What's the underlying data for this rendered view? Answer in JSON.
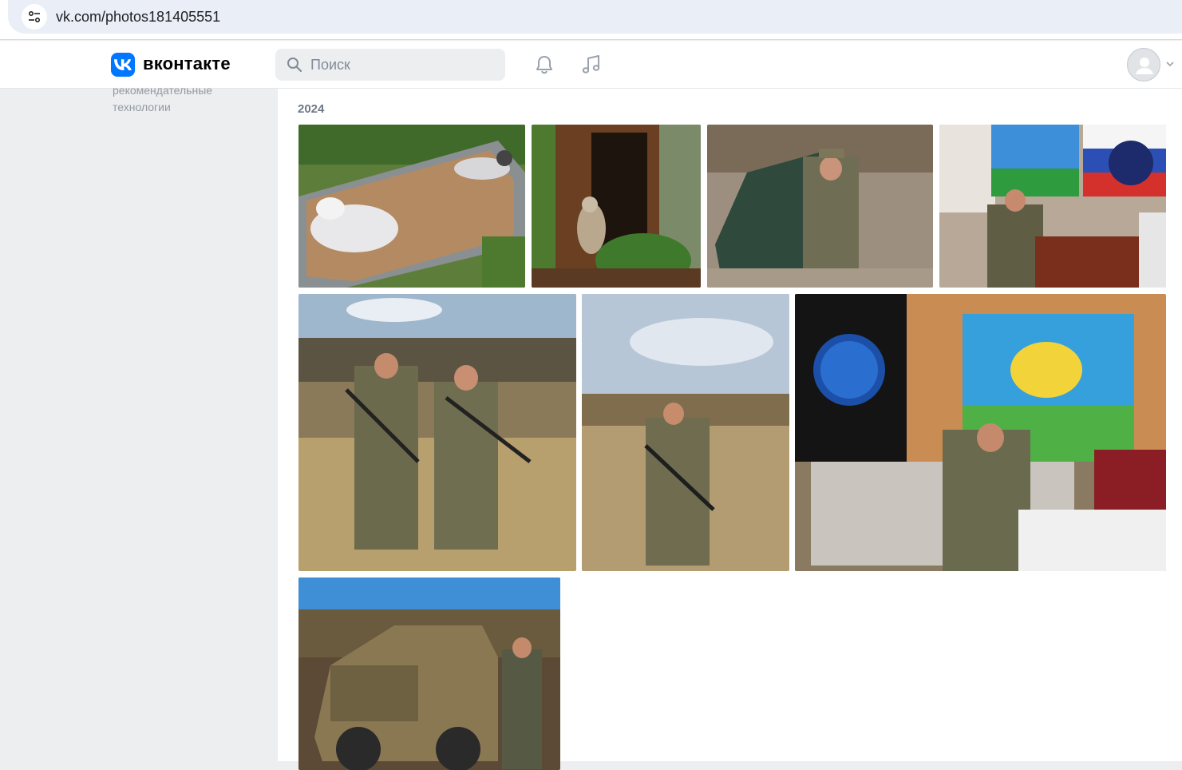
{
  "browser": {
    "url": "vk.com/photos181405551"
  },
  "header": {
    "logo_text": "вконтакте",
    "search_placeholder": "Поиск",
    "brand_color": "#0077ff"
  },
  "sidebar": {
    "text": "рекомендательные технологии"
  },
  "album": {
    "year": "2024",
    "photos": [
      {
        "subject": "husky dogs in sandbox"
      },
      {
        "subject": "husky at wooden doorway"
      },
      {
        "subject": "man in camouflage by shelter"
      },
      {
        "subject": "man seated under flags"
      },
      {
        "subject": "two soldiers with rifles in field"
      },
      {
        "subject": "soldier with rifle in field"
      },
      {
        "subject": "man seated under flags in room"
      },
      {
        "subject": "soldier beside armored vehicle"
      }
    ]
  }
}
